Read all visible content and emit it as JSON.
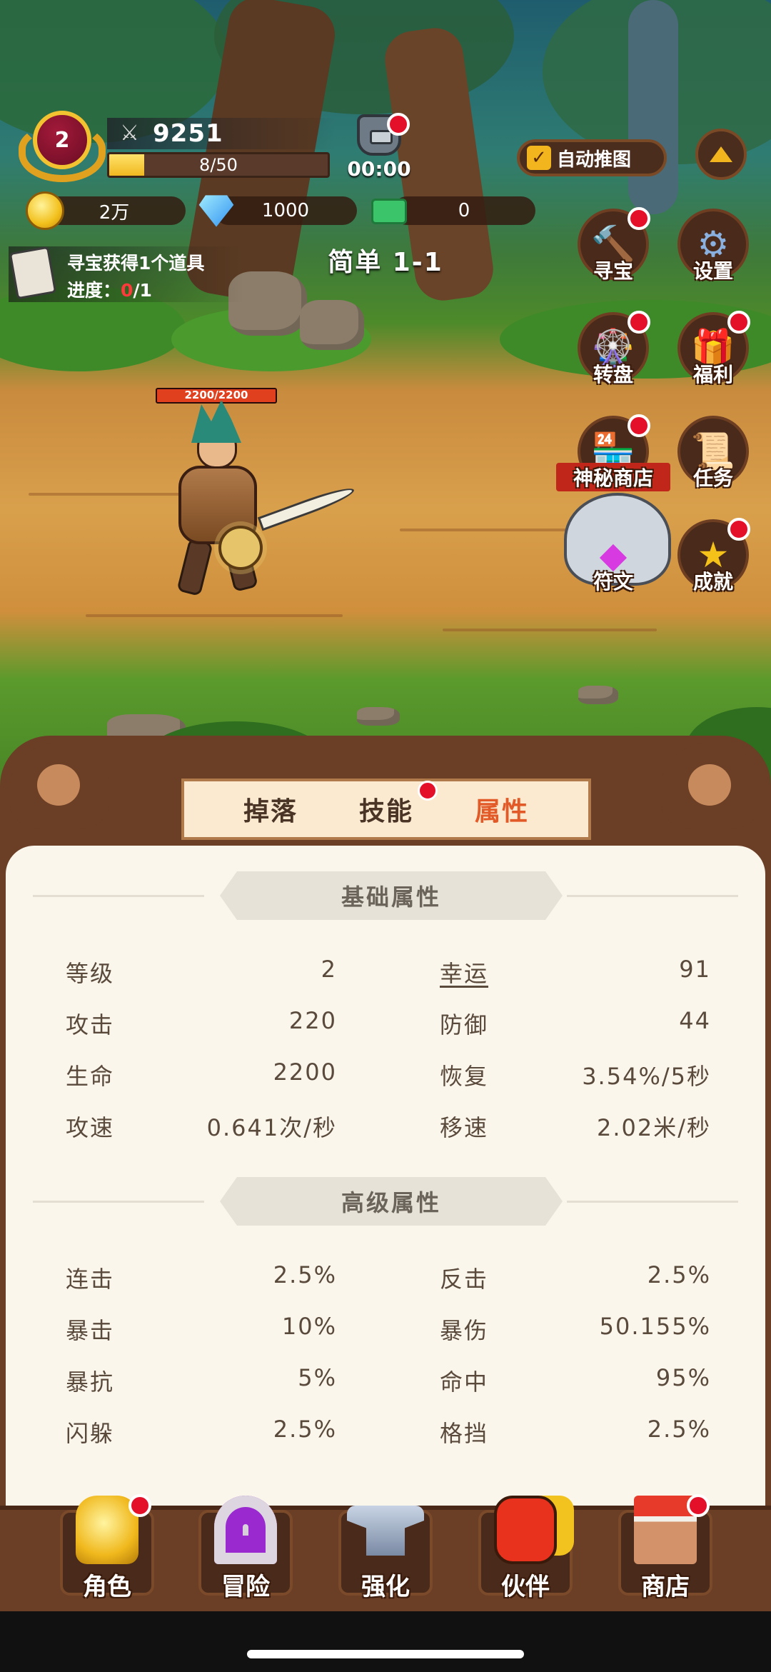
{
  "player": {
    "level": "2",
    "power": "9251",
    "exp": "8/50",
    "exp_fraction": 0.16
  },
  "boss": {
    "timer": "00:00"
  },
  "auto_push": {
    "label": "自动推图",
    "checked": true
  },
  "resources": {
    "gold": "2万",
    "diamond": "1000",
    "cash": "0"
  },
  "quest": {
    "title": "寻宝获得1个道具",
    "progress_label": "进度：",
    "progress_current": "0",
    "progress_total": "/1"
  },
  "stage": {
    "name": "简单 1-1"
  },
  "side_menu": [
    {
      "label": "寻宝",
      "icon": "hammer-icon",
      "badge": true
    },
    {
      "label": "设置",
      "icon": "gear-icon",
      "badge": false
    },
    {
      "label": "转盘",
      "icon": "wheel-icon",
      "badge": true
    },
    {
      "label": "福利",
      "icon": "gift-icon",
      "badge": true
    },
    {
      "label": "神秘商店",
      "icon": "shop-icon",
      "badge": true
    },
    {
      "label": "任务",
      "icon": "scroll-icon",
      "badge": false
    },
    {
      "label": "符文",
      "icon": "gem-icon",
      "badge": false
    },
    {
      "label": "成就",
      "icon": "star-icon",
      "badge": true
    }
  ],
  "hero": {
    "hp": "2200/2200",
    "hp_fraction": 1.0
  },
  "tabs": [
    {
      "label": "掉落",
      "active": false,
      "badge": false
    },
    {
      "label": "技能",
      "active": false,
      "badge": true
    },
    {
      "label": "属性",
      "active": true,
      "badge": false
    }
  ],
  "basic_stats": {
    "title": "基础属性",
    "rows": [
      {
        "k1": "等级",
        "v1": "2",
        "k2": "幸运",
        "v2": "91"
      },
      {
        "k1": "攻击",
        "v1": "220",
        "k2": "防御",
        "v2": "44"
      },
      {
        "k1": "生命",
        "v1": "2200",
        "k2": "恢复",
        "v2": "3.54%/5秒"
      },
      {
        "k1": "攻速",
        "v1": "0.641次/秒",
        "k2": "移速",
        "v2": "2.02米/秒"
      }
    ]
  },
  "advanced_stats": {
    "title": "高级属性",
    "rows": [
      {
        "k1": "连击",
        "v1": "2.5%",
        "k2": "反击",
        "v2": "2.5%"
      },
      {
        "k1": "暴击",
        "v1": "10%",
        "k2": "暴伤",
        "v2": "50.155%"
      },
      {
        "k1": "暴抗",
        "v1": "5%",
        "k2": "命中",
        "v2": "95%"
      },
      {
        "k1": "闪躲",
        "v1": "2.5%",
        "k2": "格挡",
        "v2": "2.5%"
      }
    ]
  },
  "bottom_nav": [
    {
      "label": "角色",
      "icon": "armor-icon",
      "badge": true
    },
    {
      "label": "冒险",
      "icon": "portal-icon",
      "badge": false
    },
    {
      "label": "强化",
      "icon": "anvil-icon",
      "badge": false
    },
    {
      "label": "伙伴",
      "icon": "partner-icon",
      "badge": false
    },
    {
      "label": "商店",
      "icon": "store-icon",
      "badge": true
    }
  ],
  "colors": {
    "accent": "#e25a28",
    "badge_red": "#e4102a",
    "panel_brown": "#6b3e26",
    "sheet_bg": "#fbf6ec"
  }
}
